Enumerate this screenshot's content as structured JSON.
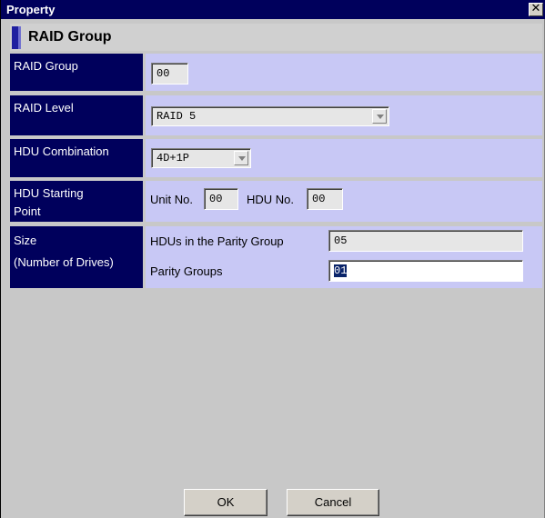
{
  "window": {
    "title": "Property",
    "close_glyph": "✕"
  },
  "section": {
    "title": "RAID Group"
  },
  "rows": {
    "raid_group": {
      "label": "RAID Group",
      "value": "00"
    },
    "raid_level": {
      "label": "RAID Level",
      "value": "RAID 5"
    },
    "hdu_combination": {
      "label": "HDU Combination",
      "value": "4D+1P"
    },
    "hdu_starting_point": {
      "label_line1": "HDU Starting",
      "label_line2": "Point",
      "unit_no_label": "Unit No.",
      "unit_no_value": "00",
      "hdu_no_label": "HDU No.",
      "hdu_no_value": "00"
    },
    "size": {
      "label_line1": "Size",
      "label_line2": "(Number of Drives)",
      "hdus_label": "HDUs in the Parity Group",
      "hdus_value": "05",
      "parity_groups_label": "Parity Groups",
      "parity_groups_value": "01"
    }
  },
  "buttons": {
    "ok": "OK",
    "cancel": "Cancel"
  },
  "icons": {
    "close": "close-icon",
    "dropdown": "chevron-down-icon"
  }
}
